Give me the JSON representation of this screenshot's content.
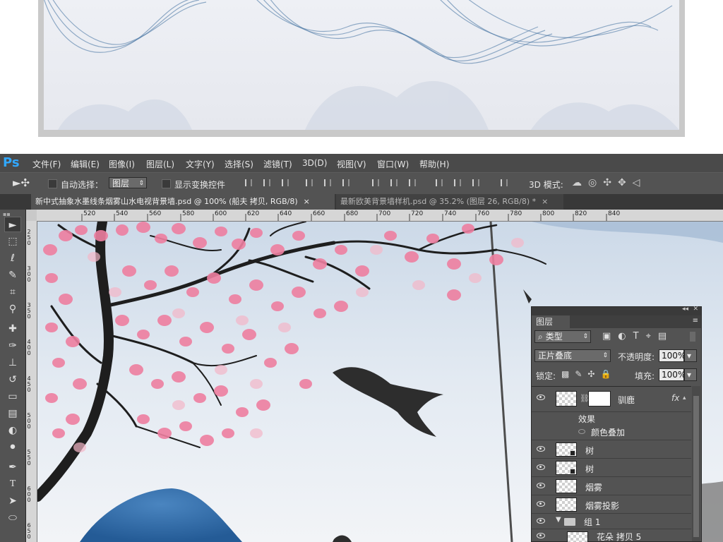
{
  "menu": {
    "logo": "Ps",
    "items": [
      "文件(F)",
      "编辑(E)",
      "图像(I)",
      "图层(L)",
      "文字(Y)",
      "选择(S)",
      "滤镜(T)",
      "3D(D)",
      "视图(V)",
      "窗口(W)",
      "帮助(H)"
    ]
  },
  "options": {
    "auto_select_label": "自动选择：",
    "auto_select_value": "图层",
    "show_transform_label": "显示变换控件",
    "mode3d_label": "3D 模式:"
  },
  "tabs": [
    {
      "label": "新中式抽象水墨线条烟雾山水电视背景墙.psd @ 100% (船夫 拷贝, RGB/8)",
      "close": "×"
    },
    {
      "label": "最新欧美背景墙样机.psd @ 35.2% (图层 26, RGB/8) *",
      "close": "×"
    }
  ],
  "ruler": {
    "h_labels": [
      "520",
      "540",
      "560",
      "580",
      "600",
      "620",
      "640",
      "660",
      "680",
      "700",
      "720",
      "740",
      "760",
      "780",
      "800",
      "820",
      "840"
    ],
    "v_labels": [
      "2\n5\n0",
      "3\n0\n0",
      "3\n5\n0",
      "4\n0\n0",
      "4\n5\n0",
      "5\n0\n0",
      "5\n5\n0",
      "6\n0\n0",
      "6\n5\n0"
    ]
  },
  "layers_panel": {
    "tab_label": "图层",
    "filter_label": "类型",
    "blend_mode": "正片叠底",
    "opacity_label": "不透明度:",
    "opacity_value": "100%",
    "lock_label": "锁定:",
    "fill_label": "填充:",
    "fill_value": "100%",
    "fx_label": "fx",
    "layers": [
      {
        "name": "驯鹿",
        "type": "masked"
      },
      {
        "name": "效果",
        "type": "effects-header"
      },
      {
        "name": "颜色叠加",
        "type": "effect"
      },
      {
        "name": "树",
        "type": "smart"
      },
      {
        "name": "树",
        "type": "smart"
      },
      {
        "name": "烟雾",
        "type": "normal"
      },
      {
        "name": "烟雾投影",
        "type": "normal"
      },
      {
        "name": "组 1",
        "type": "group"
      },
      {
        "name": "花朵 拷贝 5",
        "type": "child"
      }
    ]
  },
  "colors": {
    "panel_bg": "#535353",
    "menubar_bg": "#4a4a4a",
    "blossom": "#ee7fa0",
    "ink_blue": "#2f6aa6",
    "branch": "#1e1e1e"
  }
}
